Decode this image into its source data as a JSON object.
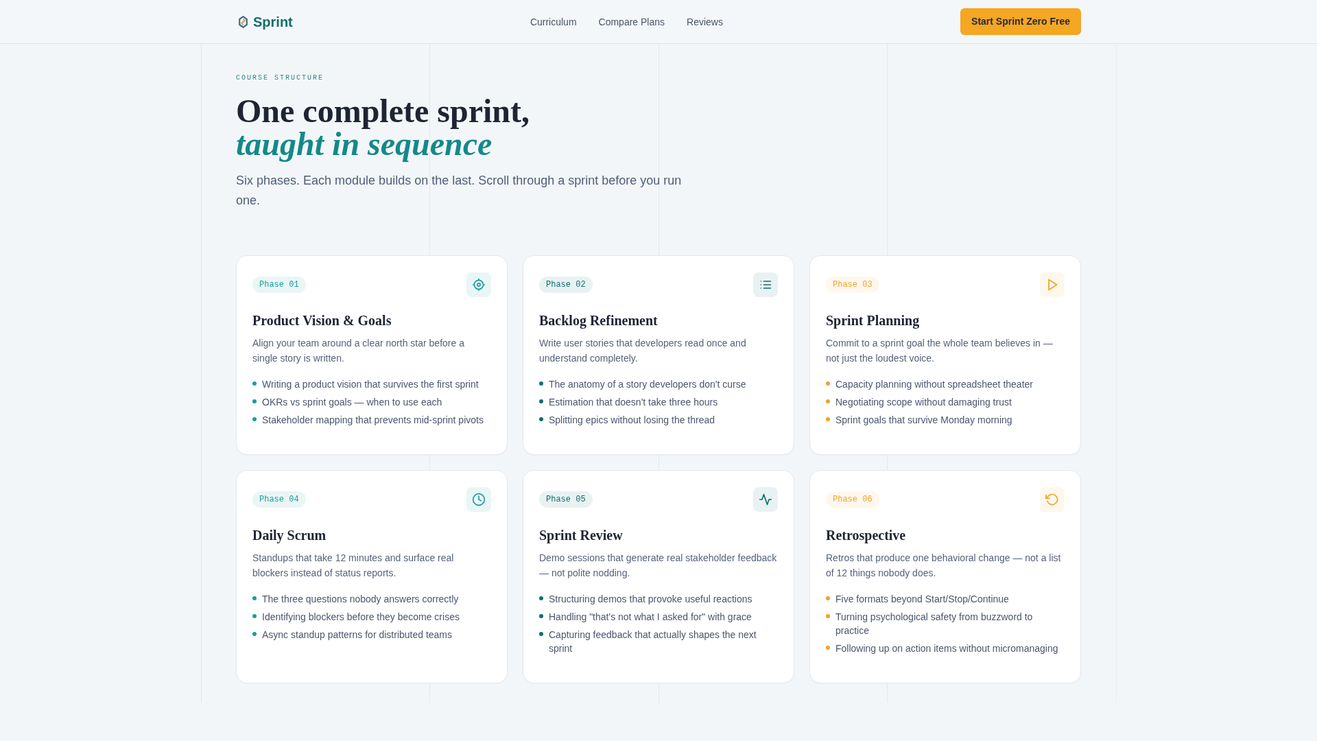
{
  "navbar": {
    "brand": "Sprint",
    "links": [
      "Curriculum",
      "Compare Plans",
      "Reviews"
    ],
    "cta": "Start Sprint Zero Free"
  },
  "hero": {
    "eyebrow": "COURSE STRUCTURE",
    "title": "One complete sprint,",
    "title_accent": "taught in sequence",
    "subtitle": "Six phases. Each module builds on the last. Scroll through a sprint before you run one."
  },
  "phases": [
    {
      "badge": "Phase 01",
      "color": "#1a9e9e",
      "title": "Product Vision & Goals",
      "description": "Align your team around a clear north star before a single story is written.",
      "topics": [
        "Writing a product vision that survives the first sprint",
        "OKRs vs sprint goals — when to use each",
        "Stakeholder mapping that prevents mid-sprint pivots"
      ]
    },
    {
      "badge": "Phase 02",
      "color": "#0f6e6e",
      "title": "Backlog Refinement",
      "description": "Write user stories that developers read once and understand completely.",
      "topics": [
        "The anatomy of a story developers don't curse",
        "Estimation that doesn't take three hours",
        "Splitting epics without losing the thread"
      ]
    },
    {
      "badge": "Phase 03",
      "color": "#f0a32c",
      "title": "Sprint Planning",
      "description": "Commit to a sprint goal the whole team believes in — not just the loudest voice.",
      "topics": [
        "Capacity planning without spreadsheet theater",
        "Negotiating scope without damaging trust",
        "Sprint goals that survive Monday morning"
      ]
    },
    {
      "badge": "Phase 04",
      "color": "#1a9e9e",
      "title": "Daily Scrum",
      "description": "Standups that take 12 minutes and surface real blockers instead of status reports.",
      "topics": [
        "The three questions nobody answers correctly",
        "Identifying blockers before they become crises",
        "Async standup patterns for distributed teams"
      ]
    },
    {
      "badge": "Phase 05",
      "color": "#0f6e6e",
      "title": "Sprint Review",
      "description": "Demo sessions that generate real stakeholder feedback — not polite nodding.",
      "topics": [
        "Structuring demos that provoke useful reactions",
        "Handling \"that's not what I asked for\" with grace",
        "Capturing feedback that actually shapes the next sprint"
      ]
    },
    {
      "badge": "Phase 06",
      "color": "#f0a32c",
      "title": "Retrospective",
      "description": "Retros that produce one behavioral change — not a list of 12 things nobody does.",
      "topics": [
        "Five formats beyond Start/Stop/Continue",
        "Turning psychological safety from buzzword to practice",
        "Following up on action items without micromanaging"
      ]
    }
  ]
}
